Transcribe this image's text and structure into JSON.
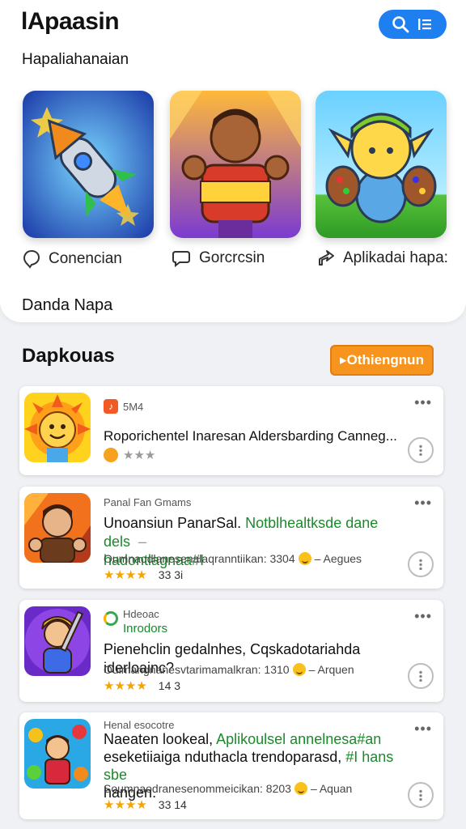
{
  "header": {
    "app_title": "lApaasin",
    "subtitle": "Hapaliahanaian",
    "search_icon": "search-icon",
    "menu_icon": "list-icon",
    "accent": "#1e7ff0"
  },
  "categories": [
    {
      "label": "Conencian",
      "icon": "pin-icon"
    },
    {
      "label": "Gorcrcsin",
      "icon": "chat-icon"
    },
    {
      "label": "Aplikadai hapa:",
      "icon": "send-icon"
    }
  ],
  "top_footer": "Danda Napa",
  "section": {
    "title": "Dapkouas",
    "button_label": "▸Othiengnun",
    "button_color": "#f7941d"
  },
  "cards": [
    {
      "publisher": "5М4",
      "headline": "Roporichentel Inaresan Aldersbarding Canneg...",
      "rating_stars": 3
    },
    {
      "publisher": "Panal Fan Gmams",
      "headline_a": "Unoansiun PanarSal. ",
      "headline_b": "Notblhealtksde dane dels",
      "headline_c": "hadontlagnaa#I",
      "meta_a": "Oumnaodlanesenalaqranntiikan: 3304",
      "meta_b": "– Aegues",
      "stars_text": "★★★★",
      "rating": "33 3i"
    },
    {
      "publisher": "Hdeoac",
      "publisher_sub": "Inrodors",
      "headline": "Pienehclin gedalnhes, Cqskadotariahda iderloainc?",
      "meta_a": "Ouimangnanesvtarimamalkran: 1310",
      "meta_b": "– Arquen",
      "stars_text": "★★★★",
      "rating": "14 3"
    },
    {
      "publisher": "Henal esocotre",
      "headline_a": "Naeaten lookeal, ",
      "headline_b": "Aplikoulsel annelnesa#an",
      "headline_c": "eseketiiaiga nduthacla trendoparasd, ",
      "headline_d": "#I hans sbe",
      "headline_e": "hangen.",
      "meta_a": "Soumnaodranesenommeicikan: 8203",
      "meta_b": "– Aquan",
      "stars_text": "★★★★",
      "rating": "33 14"
    }
  ]
}
